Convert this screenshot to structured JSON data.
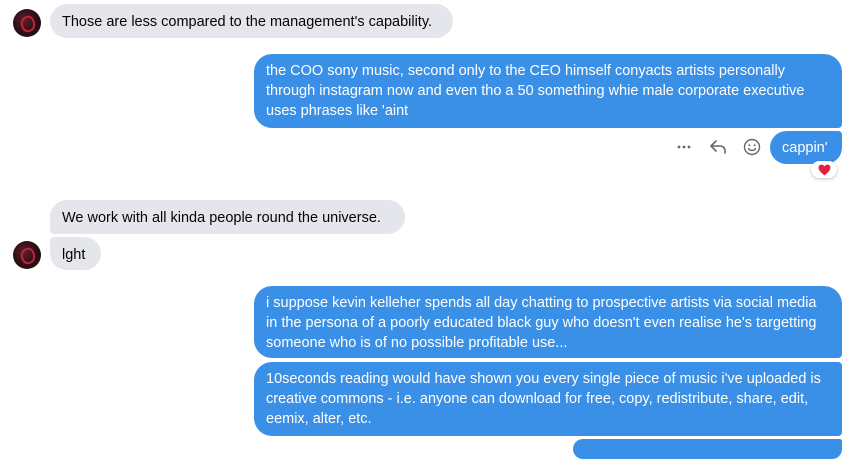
{
  "messages": [
    {
      "text": "Those are less compared to the management's capability."
    },
    {
      "text": "the COO sony music, second only to the CEO himself conyacts artists personally through instagram now and even tho a 50 something whie male corporate executive uses phrases like 'aint"
    },
    {
      "text": "cappin'"
    },
    {
      "text": "We work with all kinda people round the universe."
    },
    {
      "text": "lght"
    },
    {
      "text": "i suppose kevin kelleher spends all day chatting to prospective artists via social media in the persona of a poorly educated black guy who doesn't even realise he's targetting someone who is of no possible profitable use..."
    },
    {
      "text": "10seconds reading would have shown you every single piece of music i've uploaded is creative commons - i.e. anyone can download for free, copy, redistribute, share, edit, eemix, alter, etc."
    }
  ],
  "icons": {
    "more": "more-options-icon",
    "reply": "reply-icon",
    "react": "emoji-react-icon",
    "reaction": "heart-reaction-icon"
  },
  "colors": {
    "outgoing_bubble": "#3a8fe6",
    "incoming_bubble": "#e4e6eb",
    "reaction_heart": "#e41e3f"
  }
}
